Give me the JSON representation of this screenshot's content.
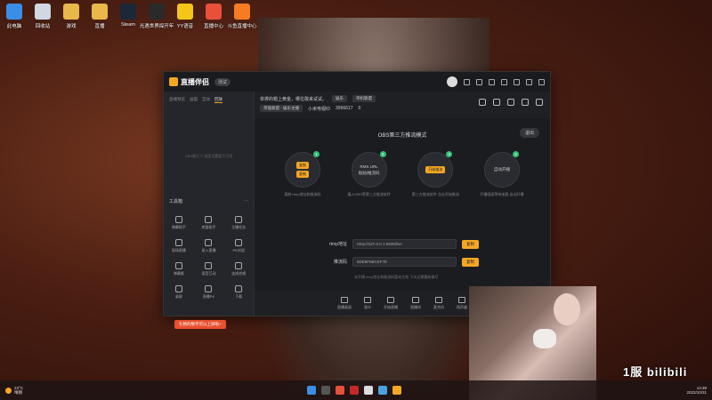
{
  "desktop": {
    "icons": [
      {
        "label": "此电脑",
        "color": "#3a8ee6"
      },
      {
        "label": "回收站",
        "color": "#cfd8e3"
      },
      {
        "label": "游戏",
        "color": "#e8b84a"
      },
      {
        "label": "直播",
        "color": "#e8b84a"
      },
      {
        "label": "Steam",
        "color": "#1b2838"
      },
      {
        "label": "光遇世界探开年",
        "color": "#2a2a2a"
      },
      {
        "label": "YY语音",
        "color": "#f5c518"
      },
      {
        "label": "直播中心",
        "color": "#e8503a"
      },
      {
        "label": "斗鱼直播中心",
        "color": "#f57c22"
      }
    ]
  },
  "app": {
    "name": "直播伴侣",
    "version": "测试",
    "left_tabs": [
      "直播预览",
      "画面",
      "互动",
      "回放"
    ],
    "left_empty_text": "OBS模式下 画面设置暂不可用",
    "tools_title": "工具箱",
    "tools": [
      "弹幕助手",
      "房管助手",
      "主播任务",
      "现场直播",
      "录入直播",
      "PK对战",
      "弹幕姬",
      "语音互动",
      "连线合唱",
      "录屏",
      "直播PK",
      "下载"
    ],
    "room": {
      "title": "单排的帽上黄金，哪位敢来试试。",
      "category_tag": "娱乐",
      "category_value": "单机联盟",
      "sub_tag": "英雄联盟 · 娱乐主播",
      "room_id_label": "小米电视ID",
      "room_id": "3966617",
      "likes": "0"
    }
  },
  "obs": {
    "title": "OBS第三方推流模式",
    "exit_label": "退出",
    "steps": [
      {
        "num": "1",
        "btn1": "复制",
        "btn2": "复制",
        "desc": "复制 rtmp地址和推流码"
      },
      {
        "num": "2",
        "text1": "RMS URL",
        "text2": "粘贴/推流码",
        "desc": "填入OBS等第三方推流软件"
      },
      {
        "num": "3",
        "btn1": "开始推流",
        "desc": "第三方推流软件 点击开始推流"
      },
      {
        "num": "4",
        "text1": "自动开播",
        "desc": "开播画面等待加载 自动开播"
      }
    ],
    "rtmp_label": "rtmp地址",
    "rtmp_value": "rtmp://127.0.0.1:5935/live",
    "rtmp_copy": "复制",
    "key_label": "推流码",
    "key_value": "5DE8F6BCEF7E",
    "key_copy": "复制",
    "hint": "未开播 rtmp地址和推流码暂未生效 下次无需重新填写"
  },
  "bottom_bar": [
    "直播画面",
    "观众",
    "开始直播",
    "直播间",
    "麦克风",
    "扬声器"
  ],
  "toast": "礼物的数字可以上屏啦~",
  "watermark": "1服 bilibili",
  "taskbar": {
    "temperature": "23°C",
    "weather": "晴朗",
    "time": "13:38",
    "date": "2022/10/31"
  }
}
